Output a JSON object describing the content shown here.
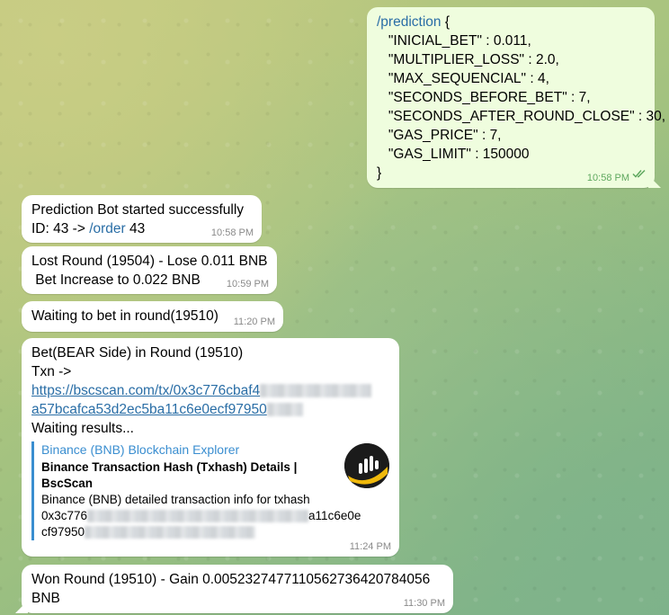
{
  "messages": {
    "prediction_cmd": {
      "lines": [
        "/prediction {",
        "   \"INICIAL_BET\" : 0.011,",
        "   \"MULTIPLIER_LOSS\" : 2.0,",
        "   \"MAX_SEQUENCIAL\" : 4,",
        "   \"SECONDS_BEFORE_BET\" : 7,",
        "   \"SECONDS_AFTER_ROUND_CLOSE\" : 30,",
        "   \"GAS_PRICE\" : 7,",
        "   \"GAS_LIMIT\" : 150000",
        "}"
      ],
      "command": "/prediction",
      "first_line_rest": " {",
      "time": "10:58 PM"
    },
    "started": {
      "line1": "Prediction Bot started successfully",
      "line2_prefix": "ID: 43 -> ",
      "line2_cmd": "/order",
      "line2_suffix": " 43",
      "time": "10:58 PM"
    },
    "lost": {
      "line1": "Lost Round (19504) - Lose 0.011 BNB",
      "line2": " Bet Increase to 0.022 BNB",
      "time": "10:59 PM"
    },
    "waiting": {
      "text": "Waiting to bet in round(19510)",
      "time": "11:20 PM"
    },
    "bet": {
      "line1": "Bet(BEAR Side) in Round (19510)",
      "line2": "Txn ->",
      "link_part1": "https://bscscan.com/tx/0x3c776cbaf4",
      "link_part2": "a57bcafca53d2ec5ba11c6e0ecf97950",
      "line_after": "Waiting results...",
      "preview": {
        "site": "Binance (BNB) Blockchain Explorer",
        "title": "Binance Transaction Hash (Txhash) Details | BscScan",
        "desc": "Binance (BNB) detailed transaction info for txhash",
        "hash_start": "0x3c776",
        "hash_mid_end": "a11c6e0e",
        "hash_line2_start": "cf97950"
      },
      "time": "11:24 PM"
    },
    "won": {
      "line1": "Won Round (19510) - Gain 0.0052327477110562736420784056",
      "line2": "BNB",
      "time": "11:30 PM"
    }
  },
  "icons": {
    "read_receipt": "double-check-icon",
    "thumbnail": "bscscan-logo-icon"
  },
  "colors": {
    "outgoing_bubble": "#effdde",
    "incoming_bubble": "#ffffff",
    "link": "#2a6ea6",
    "preview_accent": "#3a8ed0",
    "time_outgoing": "#5fa85f",
    "logo_yellow": "#f0b90b"
  }
}
